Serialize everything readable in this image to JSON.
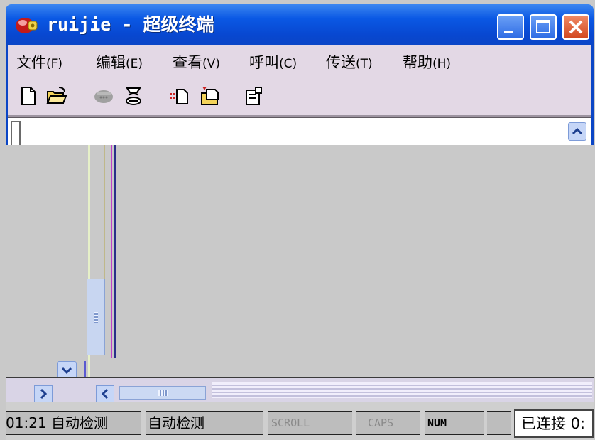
{
  "window": {
    "title": "ruijie - 超级终端",
    "controls": {
      "minimize": "minimize",
      "maximize": "maximize",
      "close": "close"
    }
  },
  "menubar": {
    "items": [
      {
        "label": "文件",
        "accel": "(F)"
      },
      {
        "label": "编辑",
        "accel": "(E)"
      },
      {
        "label": "查看",
        "accel": "(V)"
      },
      {
        "label": "呼叫",
        "accel": "(C)"
      },
      {
        "label": "传送",
        "accel": "(T)"
      },
      {
        "label": "帮助",
        "accel": "(H)"
      }
    ]
  },
  "toolbar": {
    "icons": [
      "new-file-icon",
      "open-folder-icon",
      "connect-phone-icon",
      "disconnect-phone-icon",
      "send-file-icon",
      "receive-file-icon",
      "properties-icon"
    ]
  },
  "statusbar": {
    "time": "01:21",
    "detect_1": "自动检测",
    "detect_2": "自动检测",
    "scroll": "SCROLL",
    "caps": "CAPS",
    "num": "NUM",
    "connection": "已连接 0:"
  },
  "colors": {
    "title_blue": "#0a58e4",
    "menu_bg": "#e3d8e5",
    "close_red": "#d2471e",
    "terminal_gray": "#c9c9c9"
  }
}
